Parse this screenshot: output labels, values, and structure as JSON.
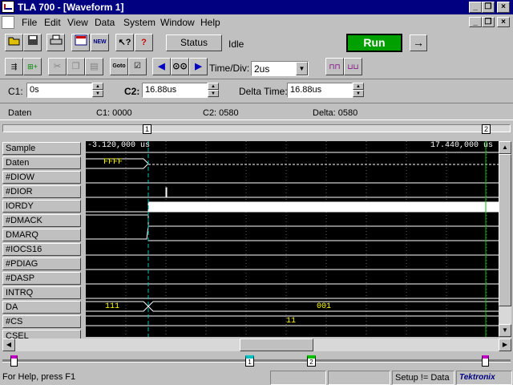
{
  "window": {
    "title": "TLA 700 - [Waveform 1]"
  },
  "menus": [
    "File",
    "Edit",
    "View",
    "Data",
    "System",
    "Window",
    "Help"
  ],
  "toolbar1": {
    "status_button": "Status",
    "state_text": "Idle",
    "run_button": "Run",
    "arrow_button": "→"
  },
  "toolbar2": {
    "timediv_label": "Time/Div:",
    "timediv_value": "2us",
    "goto_label": "Goto"
  },
  "cursors": {
    "c1_label": "C1:",
    "c1_value": "0s",
    "c2_label": "C2:",
    "c2_value": "16.88us",
    "delta_label": "Delta Time:",
    "delta_value": "16.88us"
  },
  "info": {
    "group": "Daten",
    "c1": "C1: 0000",
    "c2": "C2: 0580",
    "delta": "Delta: 0580"
  },
  "markers": {
    "m1": "1",
    "m2": "2"
  },
  "timeline": {
    "left": "-3.120,000 us",
    "right": "17.440,000 us"
  },
  "signals": [
    "Sample",
    "Daten",
    "#DIOW",
    "#DIOR",
    "IORDY",
    "#DMACK",
    "DMARQ",
    "#IOCS16",
    "#PDIAG",
    "#DASP",
    "INTRQ",
    "DA",
    "#CS",
    "CSEL"
  ],
  "values": {
    "daten": "FFFF",
    "da_before": "111",
    "da_after": "001",
    "cs": "11"
  },
  "statusbar": {
    "help": "For Help, press F1",
    "setup": "Setup != Data",
    "brand": "Tektronix"
  },
  "colors": {
    "title": "#000080",
    "run": "#00a000",
    "wave": "#ffffff",
    "grid": "#808080",
    "bus_text": "#ffff00",
    "cursor1": "#00c0c0",
    "cursor2": "#00c000"
  }
}
